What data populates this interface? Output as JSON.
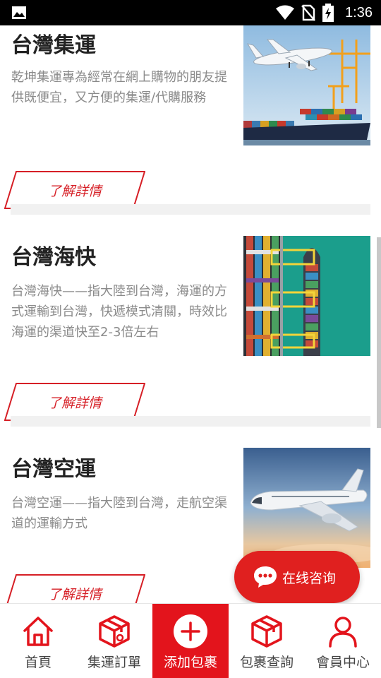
{
  "status_bar": {
    "time": "1:36",
    "icons": [
      "image-notification-icon",
      "wifi-icon",
      "no-sim-icon",
      "battery-charging-icon"
    ]
  },
  "cards": [
    {
      "title": "台灣集運",
      "description": "乾坤集運專為經常在網上購物的朋友提供既便宜，又方便的集運/代購服務",
      "button_label": "了解詳情",
      "image": "airplane-and-container-port-image"
    },
    {
      "title": "台灣海快",
      "description": "台灣海快——指大陸到台灣，海運的方式運輸到台灣，快遞模式清關，時效比海運的渠道快至2-3倍左右",
      "button_label": "了解詳情",
      "image": "container-ship-aerial-image"
    },
    {
      "title": "台灣空運",
      "description": "台灣空運——指大陸到台灣，走航空渠道的運輸方式",
      "button_label": "了解詳情",
      "image": "airplane-in-sky-image"
    }
  ],
  "chat_button": {
    "label": "在线咨询",
    "icon": "chat-bubble-icon"
  },
  "tabbar": {
    "active_index": 2,
    "accent_color": "#e3141c",
    "items": [
      {
        "label": "首頁",
        "icon": "home-icon"
      },
      {
        "label": "集運訂單",
        "icon": "package-icon"
      },
      {
        "label": "添加包裹",
        "icon": "add-circle-icon"
      },
      {
        "label": "包裹查詢",
        "icon": "box-search-icon"
      },
      {
        "label": "會員中心",
        "icon": "user-icon"
      }
    ]
  }
}
